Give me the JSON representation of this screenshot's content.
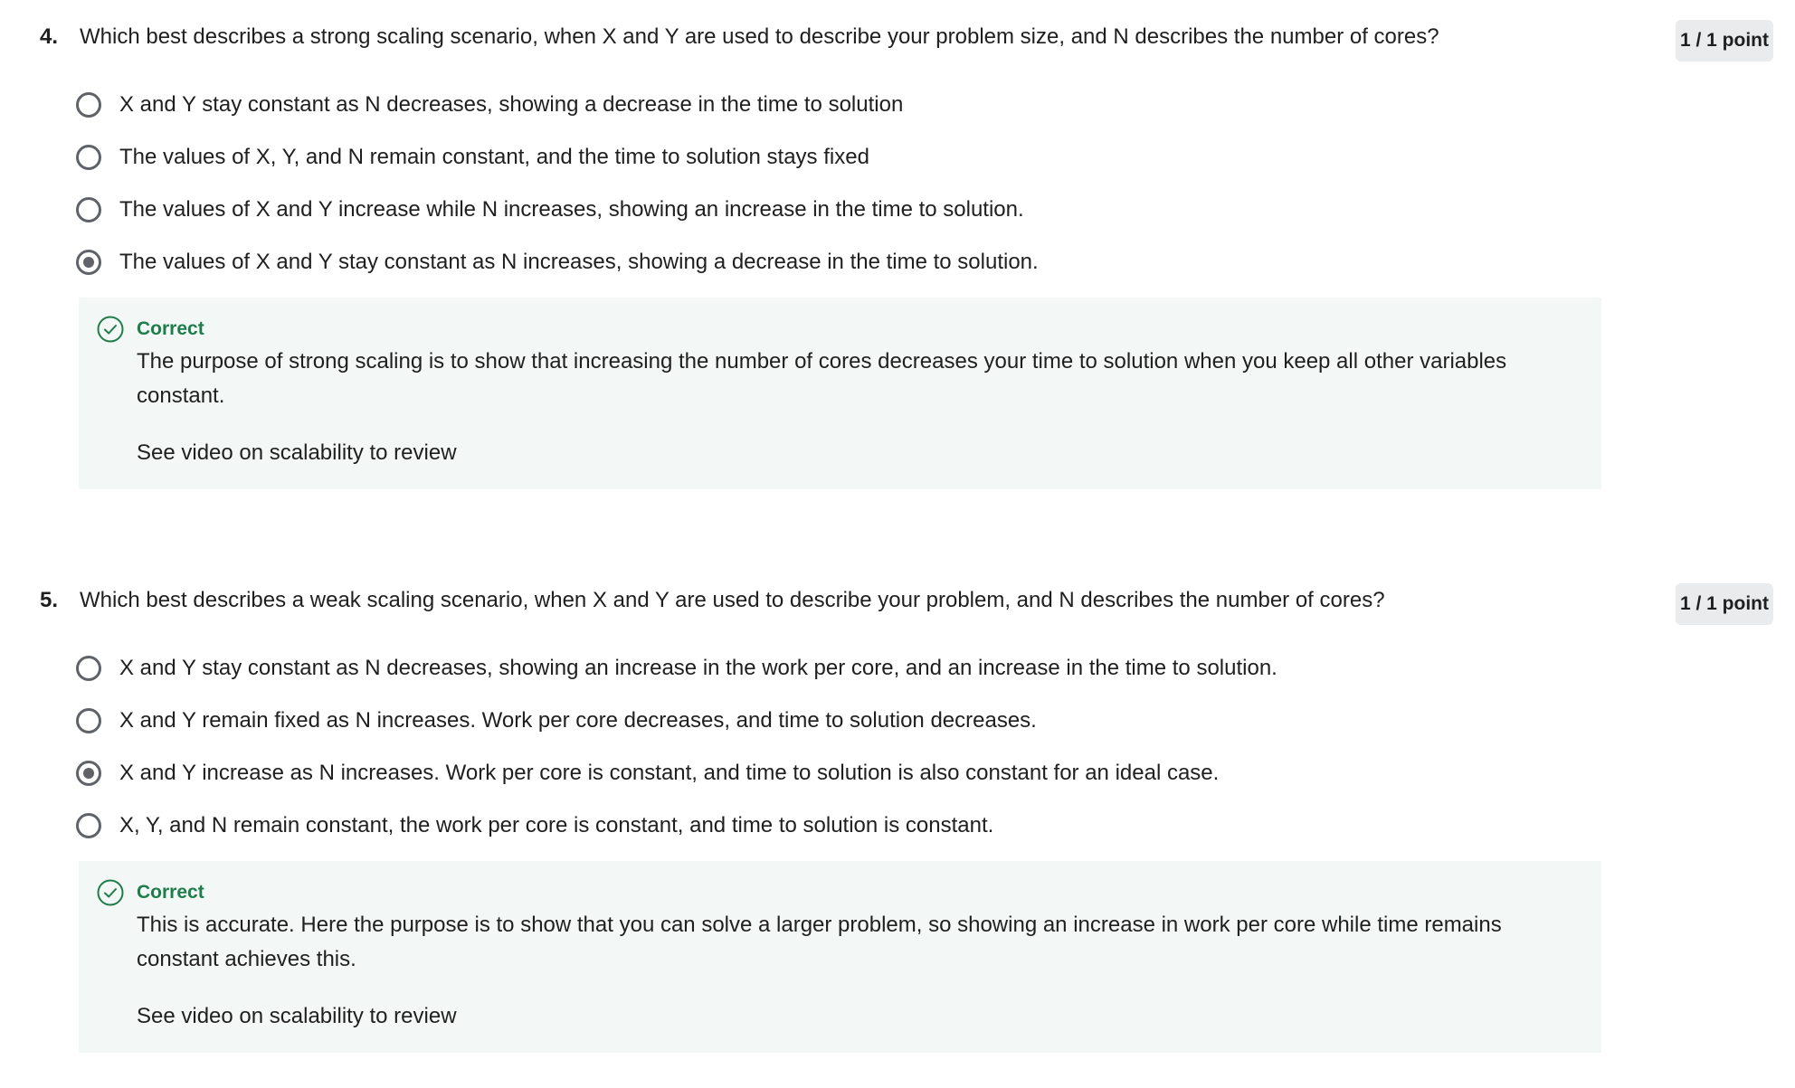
{
  "questions": [
    {
      "number": "4.",
      "text": "Which best describes a strong scaling scenario, when X and Y are used to describe your problem size, and N describes the number of cores?",
      "points": "1 / 1 point",
      "options": [
        {
          "label": "X and Y stay constant as N decreases, showing a decrease in the time to solution",
          "selected": false
        },
        {
          "label": "The values of X, Y, and N remain constant, and the time to solution stays fixed",
          "selected": false
        },
        {
          "label": "The values of X and Y increase while N increases, showing an increase in the time to solution.",
          "selected": false
        },
        {
          "label": "The values of X and Y stay constant as N increases, showing a decrease in the time to solution.",
          "selected": true
        }
      ],
      "feedback": {
        "status": "Correct",
        "body": "The purpose of strong scaling is to show that increasing the number of cores decreases your time to solution when you keep all other variables constant.",
        "review": "See video on scalability to review"
      }
    },
    {
      "number": "5.",
      "text": "Which best describes a weak scaling scenario, when X and Y are used to describe your problem, and N describes the number of cores?",
      "points": "1 / 1 point",
      "options": [
        {
          "label": "X and Y stay constant as N decreases, showing an increase in the work per core, and an increase in the time to solution.",
          "selected": false
        },
        {
          "label": "X and Y remain fixed as N increases.  Work per core decreases, and time to solution decreases.",
          "selected": false
        },
        {
          "label": "X and Y increase as N increases.  Work per core is constant, and time to solution is also constant for an ideal case.",
          "selected": true
        },
        {
          "label": "X, Y, and N remain constant, the work per core is constant, and time to solution is constant.",
          "selected": false
        }
      ],
      "feedback": {
        "status": "Correct",
        "body": "This is accurate.  Here the purpose is to show that you can solve a larger problem, so showing an increase in work per core while time remains constant achieves this.",
        "review": "See video on scalability to review"
      }
    }
  ],
  "colors": {
    "correct": "#1e7d4a",
    "feedback_bg": "#f3f8f6",
    "badge_bg": "#e9ebed",
    "radio": "#5f6368"
  }
}
